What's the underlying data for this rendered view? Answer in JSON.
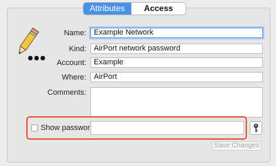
{
  "tabs": [
    {
      "label": "Attributes",
      "active": true
    },
    {
      "label": "Access Control",
      "active": false
    }
  ],
  "form": {
    "name": {
      "label": "Name:",
      "value": "Example Network"
    },
    "kind": {
      "label": "Kind:",
      "value": "AirPort network password"
    },
    "account": {
      "label": "Account:",
      "value": "Example"
    },
    "where": {
      "label": "Where:",
      "value": "AirPort"
    },
    "comments": {
      "label": "Comments:",
      "value": ""
    }
  },
  "password": {
    "checkbox_label": "Show password:",
    "checked": false,
    "value": ""
  },
  "buttons": {
    "save_label": "Save Changes"
  },
  "icons": {
    "item_icon": "pencil-icon",
    "key_icon": "key-icon"
  },
  "colors": {
    "accent": "#4a90e6",
    "highlight": "#e8573a",
    "focus_ring": "#a8c9f2"
  }
}
